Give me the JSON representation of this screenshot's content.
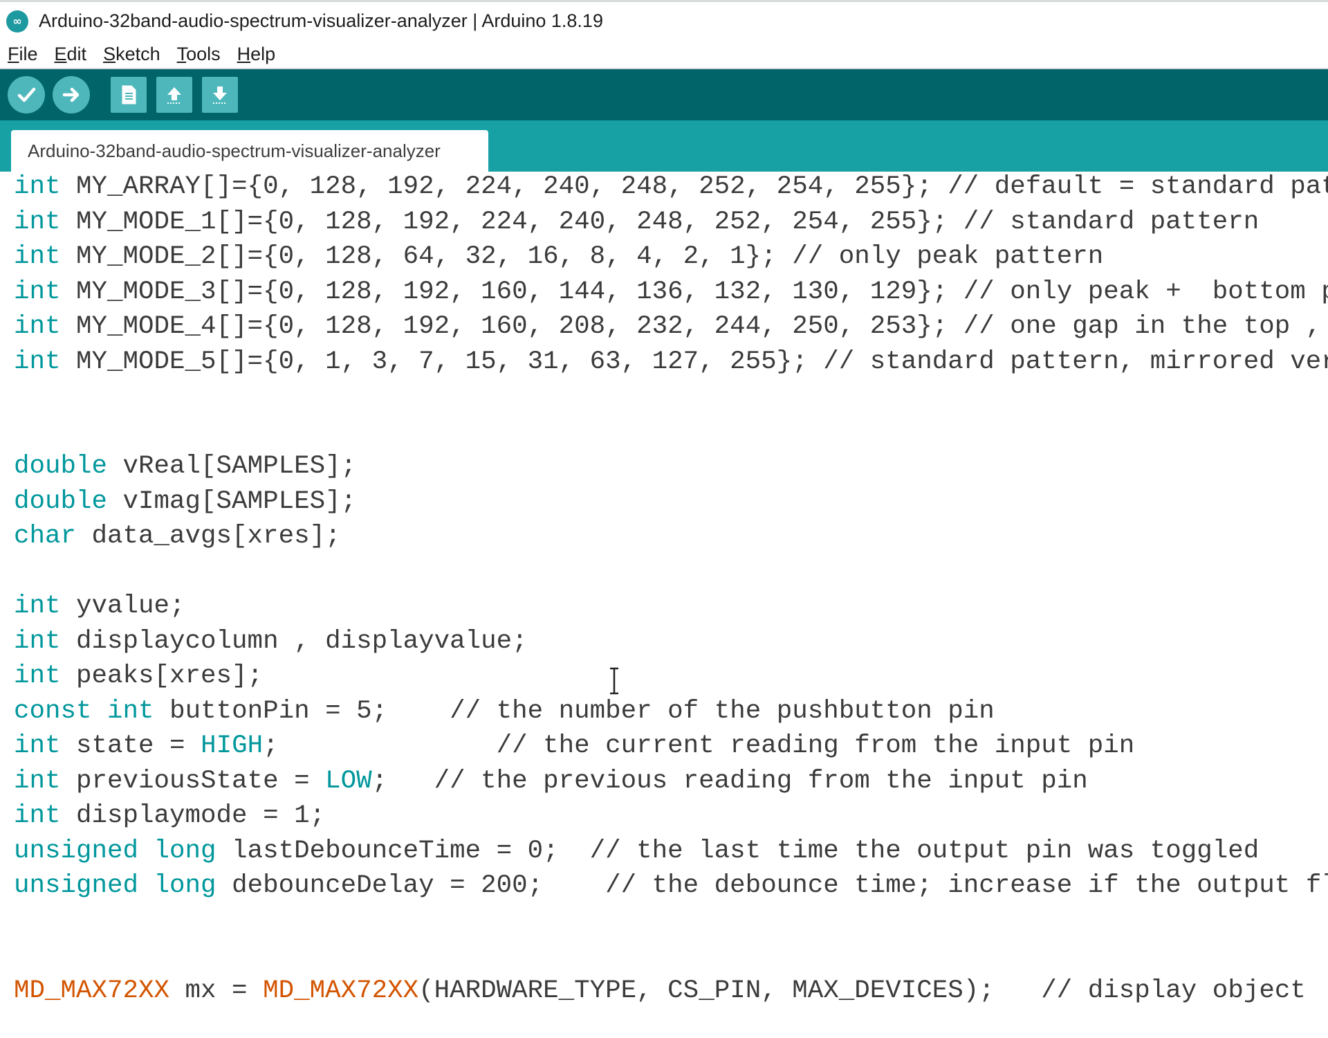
{
  "window": {
    "title": "Arduino-32band-audio-spectrum-visualizer-analyzer | Arduino 1.8.19",
    "logo_glyph": "∞"
  },
  "menu": [
    {
      "first": "F",
      "rest": "ile"
    },
    {
      "first": "E",
      "rest": "dit"
    },
    {
      "first": "S",
      "rest": "ketch"
    },
    {
      "first": "T",
      "rest": "ools"
    },
    {
      "first": "H",
      "rest": "elp"
    }
  ],
  "toolbar": {
    "buttons": [
      {
        "name": "verify-button",
        "icon": "check-icon"
      },
      {
        "name": "upload-button",
        "icon": "arrow-right-icon"
      },
      {
        "name": "new-button",
        "icon": "document-icon"
      },
      {
        "name": "open-button",
        "icon": "arrow-up-icon"
      },
      {
        "name": "save-button",
        "icon": "arrow-down-icon"
      }
    ]
  },
  "tab": {
    "label": "Arduino-32band-audio-spectrum-visualizer-analyzer"
  },
  "colors": {
    "toolbar_bg": "#006468",
    "tabstrip_bg": "#17a1a5",
    "button_bg": "#4db7bb",
    "keyword": "#00979c",
    "function": "#d35400"
  },
  "code": {
    "lines": [
      [
        [
          "kw",
          "int"
        ],
        [
          "tx",
          " MY_ARRAY[]={0, 128, 192, 224, 240, 248, 252, 254, 255}; // default = standard pat"
        ]
      ],
      [
        [
          "kw",
          "int"
        ],
        [
          "tx",
          " MY_MODE_1[]={0, 128, 192, 224, 240, 248, 252, 254, 255}; // standard pattern"
        ]
      ],
      [
        [
          "kw",
          "int"
        ],
        [
          "tx",
          " MY_MODE_2[]={0, 128, 64, 32, 16, 8, 4, 2, 1}; // only peak pattern"
        ]
      ],
      [
        [
          "kw",
          "int"
        ],
        [
          "tx",
          " MY_MODE_3[]={0, 128, 192, 160, 144, 136, 132, 130, 129}; // only peak +  bottom p"
        ]
      ],
      [
        [
          "kw",
          "int"
        ],
        [
          "tx",
          " MY_MODE_4[]={0, 128, 192, 160, 208, 232, 244, 250, 253}; // one gap in the top , "
        ]
      ],
      [
        [
          "kw",
          "int"
        ],
        [
          "tx",
          " MY_MODE_5[]={0, 1, 3, 7, 15, 31, 63, 127, 255}; // standard pattern, mirrored ver"
        ]
      ],
      [],
      [],
      [
        [
          "kw",
          "double"
        ],
        [
          "tx",
          " vReal[SAMPLES];"
        ]
      ],
      [
        [
          "kw",
          "double"
        ],
        [
          "tx",
          " vImag[SAMPLES];"
        ]
      ],
      [
        [
          "kw",
          "char"
        ],
        [
          "tx",
          " data_avgs[xres];"
        ]
      ],
      [],
      [
        [
          "kw",
          "int"
        ],
        [
          "tx",
          " yvalue;"
        ]
      ],
      [
        [
          "kw",
          "int"
        ],
        [
          "tx",
          " displaycolumn , displayvalue;"
        ]
      ],
      [
        [
          "kw",
          "int"
        ],
        [
          "tx",
          " peaks[xres];"
        ]
      ],
      [
        [
          "kw",
          "const"
        ],
        [
          "tx",
          " "
        ],
        [
          "kw",
          "int"
        ],
        [
          "tx",
          " buttonPin = 5;    // the number of the pushbutton pin"
        ]
      ],
      [
        [
          "kw",
          "int"
        ],
        [
          "tx",
          " state = "
        ],
        [
          "lit",
          "HIGH"
        ],
        [
          "tx",
          ";              // the current reading from the input pin"
        ]
      ],
      [
        [
          "kw",
          "int"
        ],
        [
          "tx",
          " previousState = "
        ],
        [
          "lit",
          "LOW"
        ],
        [
          "tx",
          ";   // the previous reading from the input pin"
        ]
      ],
      [
        [
          "kw",
          "int"
        ],
        [
          "tx",
          " displaymode = 1;"
        ]
      ],
      [
        [
          "kw",
          "unsigned"
        ],
        [
          "tx",
          " "
        ],
        [
          "kw",
          "long"
        ],
        [
          "tx",
          " lastDebounceTime = 0;  // the last time the output pin was toggled"
        ]
      ],
      [
        [
          "kw",
          "unsigned"
        ],
        [
          "tx",
          " "
        ],
        [
          "kw",
          "long"
        ],
        [
          "tx",
          " debounceDelay = 200;    // the debounce time; increase if the output fl"
        ]
      ],
      [],
      [],
      [
        [
          "fn",
          "MD_MAX72XX"
        ],
        [
          "tx",
          " mx = "
        ],
        [
          "fn",
          "MD_MAX72XX"
        ],
        [
          "tx",
          "(HARDWARE_TYPE, CS_PIN, MAX_DEVICES);   // display object"
        ]
      ]
    ]
  }
}
